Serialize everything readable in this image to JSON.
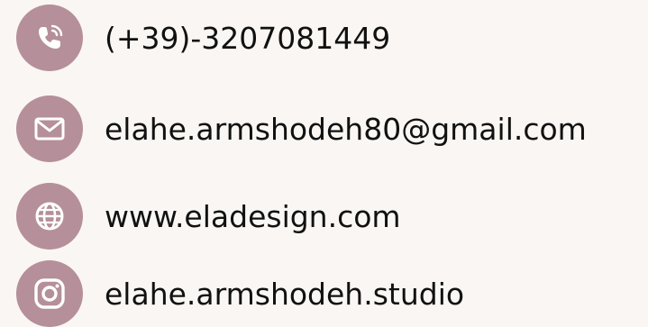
{
  "accent_color": "#b58f99",
  "background_color": "#faf6f3",
  "contacts": {
    "phone": {
      "icon": "phone-icon",
      "text": "(+39)-3207081449"
    },
    "email": {
      "icon": "mail-icon",
      "text": "elahe.armshodeh80@gmail.com"
    },
    "website": {
      "icon": "globe-icon",
      "text": "www.eladesign.com"
    },
    "instagram": {
      "icon": "instagram-icon",
      "text": "elahe.armshodeh.studio"
    }
  }
}
